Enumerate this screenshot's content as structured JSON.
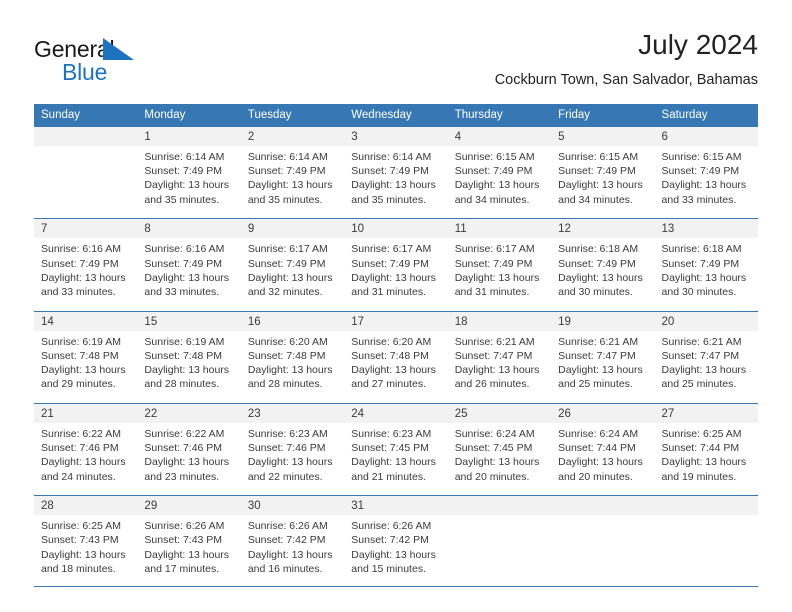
{
  "brand": {
    "name_part1": "General",
    "name_part2": "Blue",
    "accent_color": "#1e73be"
  },
  "header": {
    "title": "July 2024",
    "subtitle": "Cockburn Town, San Salvador, Bahamas"
  },
  "theme": {
    "header_row_bg": "#3778b4",
    "daynum_bg": "#f2f2f2",
    "cell_bg": "#ffffff",
    "separator": "#3778b4",
    "text": "#3b3b3b"
  },
  "weekdays": [
    "Sunday",
    "Monday",
    "Tuesday",
    "Wednesday",
    "Thursday",
    "Friday",
    "Saturday"
  ],
  "weeks": [
    {
      "days": [
        {
          "num": "",
          "l1": "",
          "l2": "",
          "l3": "",
          "l4": ""
        },
        {
          "num": "1",
          "l1": "Sunrise: 6:14 AM",
          "l2": "Sunset: 7:49 PM",
          "l3": "Daylight: 13 hours",
          "l4": "and 35 minutes."
        },
        {
          "num": "2",
          "l1": "Sunrise: 6:14 AM",
          "l2": "Sunset: 7:49 PM",
          "l3": "Daylight: 13 hours",
          "l4": "and 35 minutes."
        },
        {
          "num": "3",
          "l1": "Sunrise: 6:14 AM",
          "l2": "Sunset: 7:49 PM",
          "l3": "Daylight: 13 hours",
          "l4": "and 35 minutes."
        },
        {
          "num": "4",
          "l1": "Sunrise: 6:15 AM",
          "l2": "Sunset: 7:49 PM",
          "l3": "Daylight: 13 hours",
          "l4": "and 34 minutes."
        },
        {
          "num": "5",
          "l1": "Sunrise: 6:15 AM",
          "l2": "Sunset: 7:49 PM",
          "l3": "Daylight: 13 hours",
          "l4": "and 34 minutes."
        },
        {
          "num": "6",
          "l1": "Sunrise: 6:15 AM",
          "l2": "Sunset: 7:49 PM",
          "l3": "Daylight: 13 hours",
          "l4": "and 33 minutes."
        }
      ]
    },
    {
      "days": [
        {
          "num": "7",
          "l1": "Sunrise: 6:16 AM",
          "l2": "Sunset: 7:49 PM",
          "l3": "Daylight: 13 hours",
          "l4": "and 33 minutes."
        },
        {
          "num": "8",
          "l1": "Sunrise: 6:16 AM",
          "l2": "Sunset: 7:49 PM",
          "l3": "Daylight: 13 hours",
          "l4": "and 33 minutes."
        },
        {
          "num": "9",
          "l1": "Sunrise: 6:17 AM",
          "l2": "Sunset: 7:49 PM",
          "l3": "Daylight: 13 hours",
          "l4": "and 32 minutes."
        },
        {
          "num": "10",
          "l1": "Sunrise: 6:17 AM",
          "l2": "Sunset: 7:49 PM",
          "l3": "Daylight: 13 hours",
          "l4": "and 31 minutes."
        },
        {
          "num": "11",
          "l1": "Sunrise: 6:17 AM",
          "l2": "Sunset: 7:49 PM",
          "l3": "Daylight: 13 hours",
          "l4": "and 31 minutes."
        },
        {
          "num": "12",
          "l1": "Sunrise: 6:18 AM",
          "l2": "Sunset: 7:49 PM",
          "l3": "Daylight: 13 hours",
          "l4": "and 30 minutes."
        },
        {
          "num": "13",
          "l1": "Sunrise: 6:18 AM",
          "l2": "Sunset: 7:49 PM",
          "l3": "Daylight: 13 hours",
          "l4": "and 30 minutes."
        }
      ]
    },
    {
      "days": [
        {
          "num": "14",
          "l1": "Sunrise: 6:19 AM",
          "l2": "Sunset: 7:48 PM",
          "l3": "Daylight: 13 hours",
          "l4": "and 29 minutes."
        },
        {
          "num": "15",
          "l1": "Sunrise: 6:19 AM",
          "l2": "Sunset: 7:48 PM",
          "l3": "Daylight: 13 hours",
          "l4": "and 28 minutes."
        },
        {
          "num": "16",
          "l1": "Sunrise: 6:20 AM",
          "l2": "Sunset: 7:48 PM",
          "l3": "Daylight: 13 hours",
          "l4": "and 28 minutes."
        },
        {
          "num": "17",
          "l1": "Sunrise: 6:20 AM",
          "l2": "Sunset: 7:48 PM",
          "l3": "Daylight: 13 hours",
          "l4": "and 27 minutes."
        },
        {
          "num": "18",
          "l1": "Sunrise: 6:21 AM",
          "l2": "Sunset: 7:47 PM",
          "l3": "Daylight: 13 hours",
          "l4": "and 26 minutes."
        },
        {
          "num": "19",
          "l1": "Sunrise: 6:21 AM",
          "l2": "Sunset: 7:47 PM",
          "l3": "Daylight: 13 hours",
          "l4": "and 25 minutes."
        },
        {
          "num": "20",
          "l1": "Sunrise: 6:21 AM",
          "l2": "Sunset: 7:47 PM",
          "l3": "Daylight: 13 hours",
          "l4": "and 25 minutes."
        }
      ]
    },
    {
      "days": [
        {
          "num": "21",
          "l1": "Sunrise: 6:22 AM",
          "l2": "Sunset: 7:46 PM",
          "l3": "Daylight: 13 hours",
          "l4": "and 24 minutes."
        },
        {
          "num": "22",
          "l1": "Sunrise: 6:22 AM",
          "l2": "Sunset: 7:46 PM",
          "l3": "Daylight: 13 hours",
          "l4": "and 23 minutes."
        },
        {
          "num": "23",
          "l1": "Sunrise: 6:23 AM",
          "l2": "Sunset: 7:46 PM",
          "l3": "Daylight: 13 hours",
          "l4": "and 22 minutes."
        },
        {
          "num": "24",
          "l1": "Sunrise: 6:23 AM",
          "l2": "Sunset: 7:45 PM",
          "l3": "Daylight: 13 hours",
          "l4": "and 21 minutes."
        },
        {
          "num": "25",
          "l1": "Sunrise: 6:24 AM",
          "l2": "Sunset: 7:45 PM",
          "l3": "Daylight: 13 hours",
          "l4": "and 20 minutes."
        },
        {
          "num": "26",
          "l1": "Sunrise: 6:24 AM",
          "l2": "Sunset: 7:44 PM",
          "l3": "Daylight: 13 hours",
          "l4": "and 20 minutes."
        },
        {
          "num": "27",
          "l1": "Sunrise: 6:25 AM",
          "l2": "Sunset: 7:44 PM",
          "l3": "Daylight: 13 hours",
          "l4": "and 19 minutes."
        }
      ]
    },
    {
      "days": [
        {
          "num": "28",
          "l1": "Sunrise: 6:25 AM",
          "l2": "Sunset: 7:43 PM",
          "l3": "Daylight: 13 hours",
          "l4": "and 18 minutes."
        },
        {
          "num": "29",
          "l1": "Sunrise: 6:26 AM",
          "l2": "Sunset: 7:43 PM",
          "l3": "Daylight: 13 hours",
          "l4": "and 17 minutes."
        },
        {
          "num": "30",
          "l1": "Sunrise: 6:26 AM",
          "l2": "Sunset: 7:42 PM",
          "l3": "Daylight: 13 hours",
          "l4": "and 16 minutes."
        },
        {
          "num": "31",
          "l1": "Sunrise: 6:26 AM",
          "l2": "Sunset: 7:42 PM",
          "l3": "Daylight: 13 hours",
          "l4": "and 15 minutes."
        },
        {
          "num": "",
          "l1": "",
          "l2": "",
          "l3": "",
          "l4": ""
        },
        {
          "num": "",
          "l1": "",
          "l2": "",
          "l3": "",
          "l4": ""
        },
        {
          "num": "",
          "l1": "",
          "l2": "",
          "l3": "",
          "l4": ""
        }
      ]
    }
  ]
}
